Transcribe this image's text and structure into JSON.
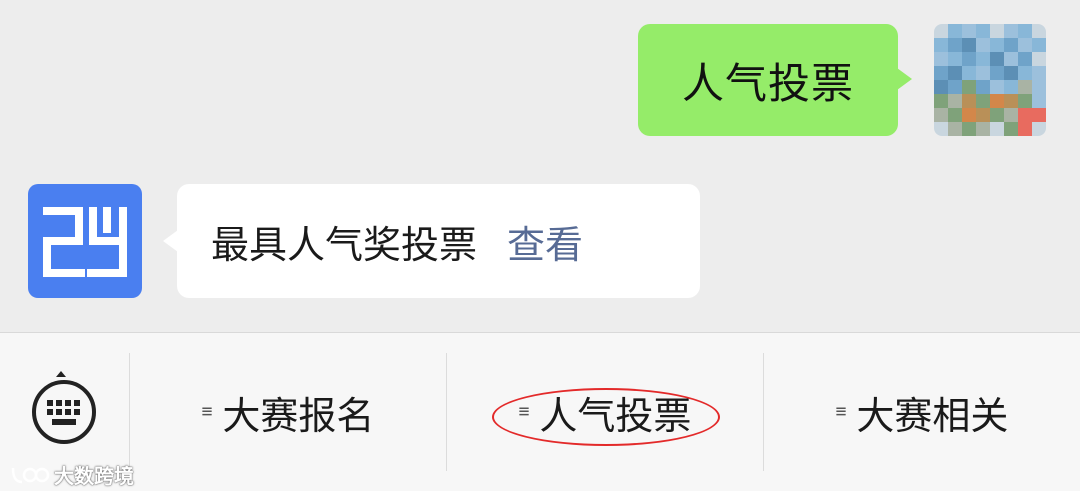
{
  "chat": {
    "outgoing": {
      "text": "人气投票"
    },
    "incoming": {
      "text": "最具人气奖投票",
      "link": "查看"
    }
  },
  "menu": {
    "items": [
      {
        "label": "大赛报名"
      },
      {
        "label": "人气投票"
      },
      {
        "label": "大赛相关"
      }
    ],
    "lines_glyph": "≡"
  },
  "watermark": {
    "text": "大数跨境"
  },
  "colors": {
    "chat_bg": "#ededed",
    "outgoing_bubble": "#95ec69",
    "incoming_bubble": "#ffffff",
    "link": "#576b95",
    "brand_blue": "#4a7ff0",
    "highlight_circle": "#e32a2a"
  }
}
